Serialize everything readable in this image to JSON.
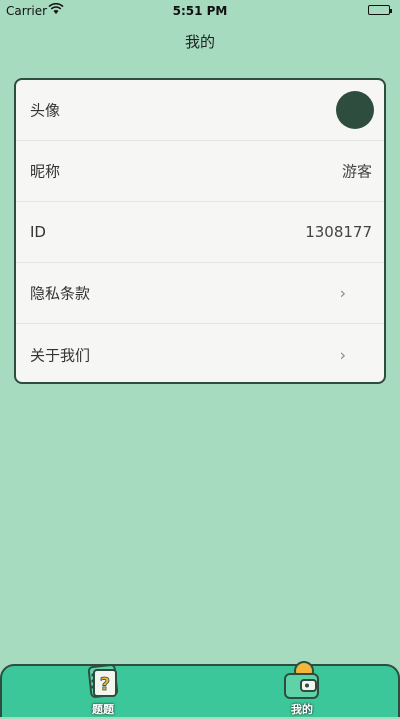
{
  "status_bar": {
    "carrier": "Carrier",
    "time": "5:51 PM"
  },
  "nav": {
    "title": "我的"
  },
  "profile": {
    "avatar_label": "头像",
    "nickname_label": "昵称",
    "nickname_value": "游客",
    "id_label": "ID",
    "id_value": "1308177",
    "privacy_label": "隐私条款",
    "about_label": "关于我们",
    "chevron": "›"
  },
  "tabs": [
    {
      "label": "题题",
      "icon": "question-card-icon",
      "active": false
    },
    {
      "label": "我的",
      "icon": "wallet-icon",
      "active": true
    }
  ],
  "colors": {
    "background": "#a6dbc0",
    "card": "#f6f7f4",
    "outline": "#2f4d3f",
    "tab_bar": "#3cc79b",
    "avatar": "#2f4d3f"
  }
}
